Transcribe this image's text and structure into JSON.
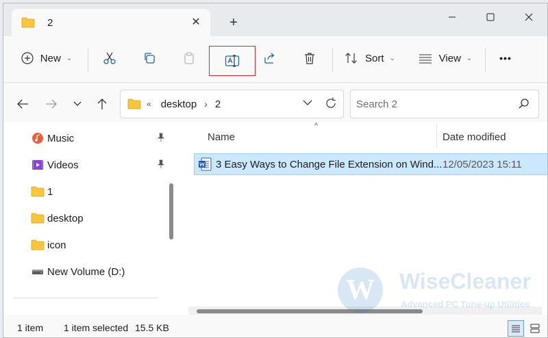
{
  "tab": {
    "title": "2",
    "close_icon": "close-icon",
    "new_tab_icon": "plus-icon"
  },
  "window_controls": {
    "minimize": "minimize-icon",
    "maximize": "maximize-icon",
    "close": "close-icon"
  },
  "toolbar": {
    "new_label": "New",
    "sort_label": "Sort",
    "view_label": "View",
    "more_label": "•••"
  },
  "address": {
    "overflow": "«",
    "segments": [
      "desktop",
      "2"
    ]
  },
  "search": {
    "placeholder": "Search 2"
  },
  "nav_items": [
    {
      "label": "Music",
      "icon": "music-icon",
      "pinned": true
    },
    {
      "label": "Videos",
      "icon": "videos-icon",
      "pinned": true
    },
    {
      "label": "1",
      "icon": "folder-icon",
      "pinned": false
    },
    {
      "label": "desktop",
      "icon": "folder-icon",
      "pinned": false
    },
    {
      "label": "icon",
      "icon": "folder-icon",
      "pinned": false
    },
    {
      "label": "New Volume (D:)",
      "icon": "drive-icon",
      "pinned": false
    }
  ],
  "columns": {
    "name": "Name",
    "date": "Date modified"
  },
  "files": [
    {
      "name": "3 Easy Ways to Change File Extension on Wind...",
      "date": "12/05/2023 15:11",
      "icon": "word-doc-icon",
      "selected": true
    }
  ],
  "status": {
    "count": "1 item",
    "selected": "1 item selected",
    "size": "15.5 KB"
  },
  "watermark": {
    "name": "WiseCleaner",
    "tagline": "Advanced PC Tune-up Utilities",
    "logo_letter": "W"
  },
  "colors": {
    "selection_bg": "#cce8ff",
    "highlight_border": "#e0262d",
    "folder": "#f8c63d"
  }
}
